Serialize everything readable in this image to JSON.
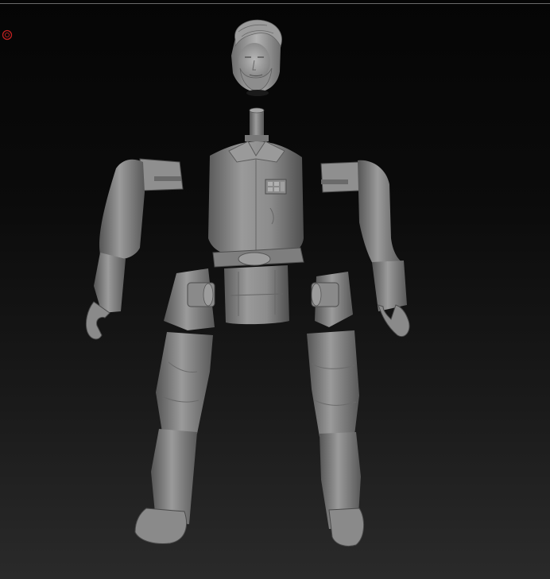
{
  "viewport": {
    "background_top": "#050505",
    "background_bottom": "#2a2a2a"
  },
  "indicator": {
    "icon": "record-circle-icon",
    "color": "#c02020"
  },
  "model": {
    "material_color": "#8a8a8a",
    "parts": [
      "head",
      "neck-peg",
      "torso",
      "belt",
      "left-arm",
      "right-arm",
      "left-leg",
      "right-leg"
    ]
  }
}
